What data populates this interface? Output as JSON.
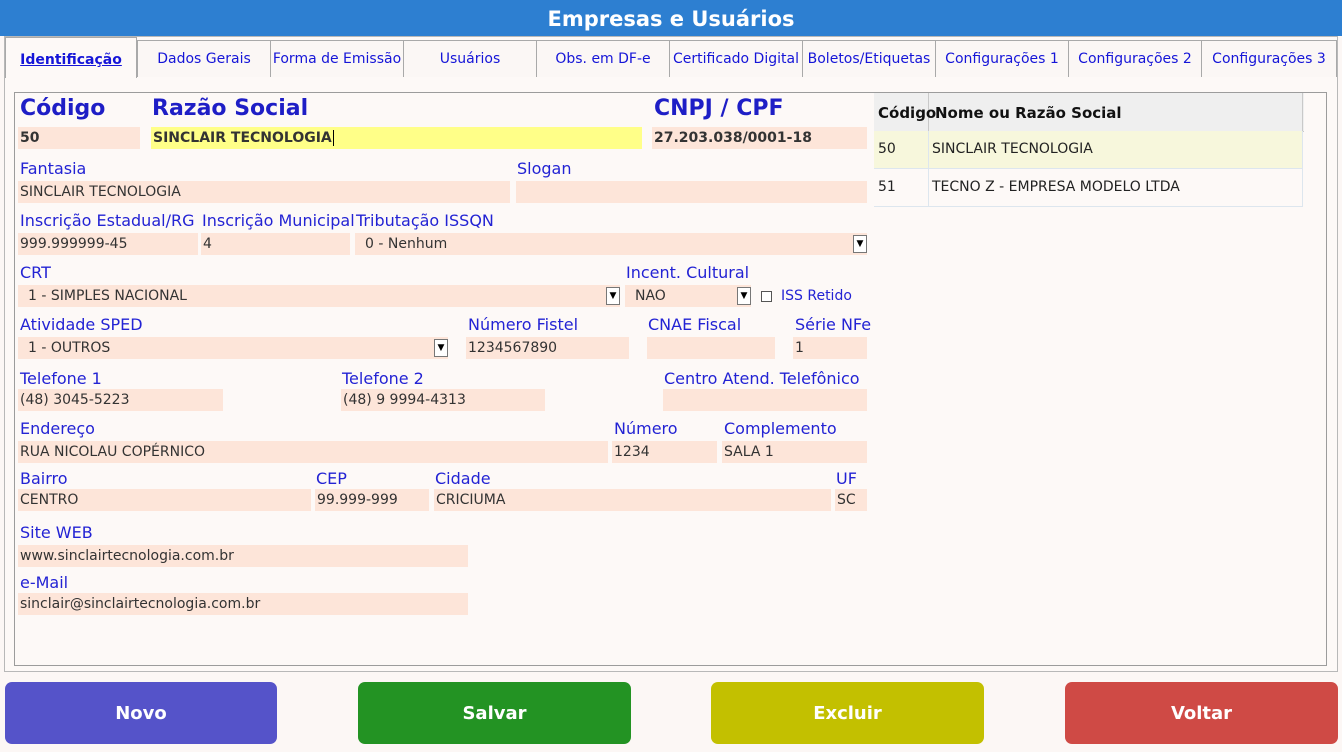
{
  "window": {
    "title": "Empresas e Usuários"
  },
  "tabs": [
    {
      "label": "Identificação"
    },
    {
      "label": "Dados Gerais"
    },
    {
      "label": "Forma de Emissão"
    },
    {
      "label": "Usuários"
    },
    {
      "label": "Obs. em DF-e"
    },
    {
      "label": "Certificado Digital"
    },
    {
      "label": "Boletos/Etiquetas"
    },
    {
      "label": "Configurações 1"
    },
    {
      "label": "Configurações 2"
    },
    {
      "label": "Configurações 3"
    }
  ],
  "form": {
    "codigo": {
      "label": "Código",
      "value": "50"
    },
    "razao_social": {
      "label": "Razão Social",
      "value": "SINCLAIR TECNOLOGIA"
    },
    "cnpj": {
      "label": "CNPJ / CPF",
      "value": "27.203.038/0001-18"
    },
    "fantasia": {
      "label": "Fantasia",
      "value": "SINCLAIR TECNOLOGIA"
    },
    "slogan": {
      "label": "Slogan",
      "value": ""
    },
    "inscricao_estadual": {
      "label": "Inscrição Estadual/RG",
      "value": "999.999999-45"
    },
    "inscricao_municipal": {
      "label": "Inscrição Municipal",
      "value": "4"
    },
    "tributacao_issqn": {
      "label": "Tributação ISSQN",
      "value": "0 - Nenhum"
    },
    "crt": {
      "label": "CRT",
      "value": "1 - SIMPLES NACIONAL"
    },
    "incent_cultural": {
      "label": "Incent. Cultural",
      "value": "NAO"
    },
    "iss_retido": {
      "label": "ISS Retido",
      "checked": false
    },
    "atividade_sped": {
      "label": "Atividade SPED",
      "value": "1 - OUTROS"
    },
    "numero_fistel": {
      "label": "Número Fistel",
      "value": "1234567890"
    },
    "cnae_fiscal": {
      "label": "CNAE Fiscal",
      "value": ""
    },
    "serie_nfe": {
      "label": "Série NFe",
      "value": "1"
    },
    "telefone1": {
      "label": "Telefone 1",
      "value": "(48) 3045-5223"
    },
    "telefone2": {
      "label": "Telefone 2",
      "value": "(48) 9 9994-4313"
    },
    "centro_atend": {
      "label": "Centro Atend. Telefônico",
      "value": ""
    },
    "endereco": {
      "label": "Endereço",
      "value": "RUA NICOLAU COPÉRNICO"
    },
    "numero": {
      "label": "Número",
      "value": "1234"
    },
    "complemento": {
      "label": "Complemento",
      "value": "SALA 1"
    },
    "bairro": {
      "label": "Bairro",
      "value": "CENTRO"
    },
    "cep": {
      "label": "CEP",
      "value": "99.999-999"
    },
    "cidade": {
      "label": "Cidade",
      "value": "CRICIUMA"
    },
    "uf": {
      "label": "UF",
      "value": "SC"
    },
    "site": {
      "label": "Site WEB",
      "value": "www.sinclairtecnologia.com.br"
    },
    "email": {
      "label": "e-Mail",
      "value": "sinclair@sinclairtecnologia.com.br"
    }
  },
  "grid": {
    "headers": {
      "codigo": "Código",
      "nome": "Nome ou Razão Social"
    },
    "rows": [
      {
        "codigo": "50",
        "nome": "SINCLAIR TECNOLOGIA"
      },
      {
        "codigo": "51",
        "nome": "TECNO Z - EMPRESA MODELO LTDA"
      }
    ]
  },
  "buttons": {
    "novo": "Novo",
    "salvar": "Salvar",
    "excluir": "Excluir",
    "voltar": "Voltar"
  },
  "colors": {
    "titlebar": "#2d7fd1",
    "novo": "#5553c9",
    "salvar": "#239323",
    "excluir": "#c3c000",
    "voltar": "#cf4a45",
    "field_bg": "#fde5d9",
    "field_focus": "#ffff88"
  }
}
